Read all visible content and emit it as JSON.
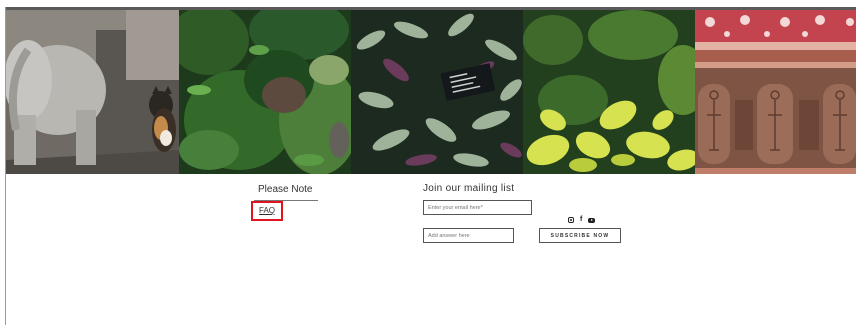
{
  "gallery": {
    "images": [
      {
        "name": "stone-elephant-and-cat-photo"
      },
      {
        "name": "green-shrubs-photo"
      },
      {
        "name": "striped-leaf-plants-photo"
      },
      {
        "name": "yellow-green-leaves-photo"
      },
      {
        "name": "temple-wall-carvings-photo"
      }
    ]
  },
  "footer": {
    "please_note": {
      "title": "Please Note",
      "faq_label": "FAQ"
    },
    "mailing": {
      "title": "Join our mailing list",
      "email_placeholder": "Enter your email here*",
      "answer_placeholder": "Add answer here",
      "subscribe_label": "SUBSCRIBE NOW"
    },
    "social": {
      "icons": [
        "instagram-icon",
        "facebook-icon",
        "youtube-icon"
      ]
    }
  },
  "colors": {
    "highlight_box": "#e0141e",
    "text": "#333333"
  }
}
